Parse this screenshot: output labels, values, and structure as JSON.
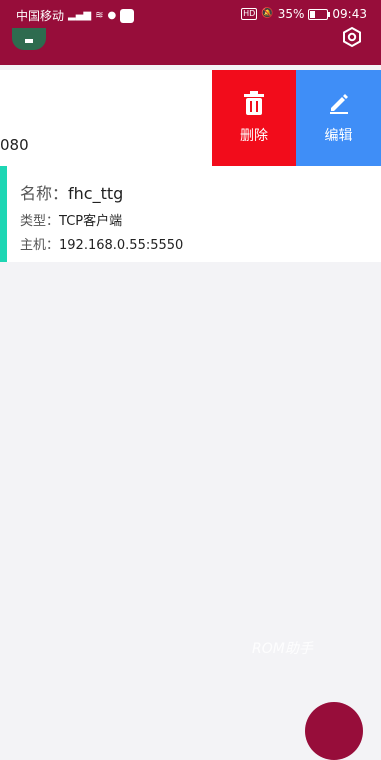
{
  "status_bar": {
    "carrier": "中国移动",
    "signal": "4G",
    "battery": "35%",
    "time": "09:43",
    "hd": "HD"
  },
  "colors": {
    "app_bar": "#970d3a",
    "delete": "#f20c1b",
    "edit": "#3f8ef7",
    "accent": "#1ed6b4"
  },
  "swiped_item": {
    "partial_text": "080",
    "delete_label": "删除",
    "edit_label": "编辑"
  },
  "connection": {
    "name_key": "名称：",
    "name_value": "fhc_ttg",
    "type_key": "类型：",
    "type_value": "TCP客户端",
    "host_key": "主机：",
    "host_value": "192.168.0.55:5550"
  },
  "watermark": "ROM助手"
}
